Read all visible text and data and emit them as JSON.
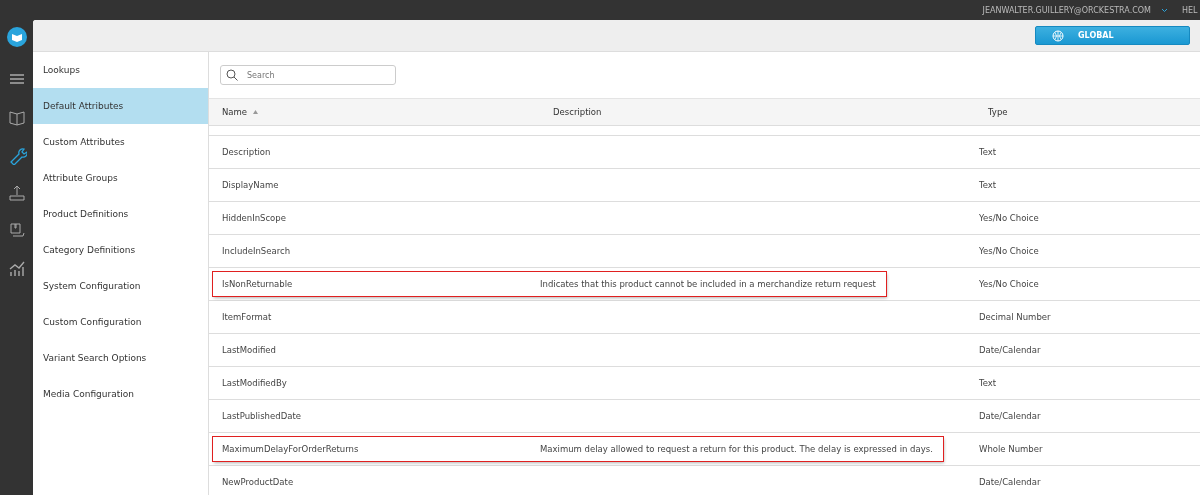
{
  "top_bar": {
    "user": "JEANWALTER.GUILLERY@ORCKESTRA.COM",
    "help": "HEL"
  },
  "rail": [
    {
      "kind": "menu",
      "selected": false
    },
    {
      "kind": "book",
      "selected": false
    },
    {
      "kind": "wrench",
      "selected": true
    },
    {
      "kind": "upload",
      "selected": false
    },
    {
      "kind": "box",
      "selected": false
    },
    {
      "kind": "chart",
      "selected": false
    }
  ],
  "scope_button": {
    "label": "GLOBAL"
  },
  "sidebar": {
    "items": [
      {
        "label": "Lookups",
        "selected": false
      },
      {
        "label": "Default Attributes",
        "selected": true
      },
      {
        "label": "Custom Attributes",
        "selected": false
      },
      {
        "label": "Attribute Groups",
        "selected": false
      },
      {
        "label": "Product Definitions",
        "selected": false
      },
      {
        "label": "Category Definitions",
        "selected": false
      },
      {
        "label": "System Configuration",
        "selected": false
      },
      {
        "label": "Custom Configuration",
        "selected": false
      },
      {
        "label": "Variant Search Options",
        "selected": false
      },
      {
        "label": "Media Configuration",
        "selected": false
      }
    ]
  },
  "search": {
    "placeholder": "Search"
  },
  "table": {
    "columns": [
      {
        "label": "Name",
        "sorted": true
      },
      {
        "label": "Description",
        "sorted": false
      },
      {
        "label": "Type",
        "sorted": false
      }
    ],
    "rows": [
      {
        "name": "Description",
        "type": "Text",
        "highlighted": false
      },
      {
        "name": "DisplayName",
        "type": "Text",
        "highlighted": false
      },
      {
        "name": "HiddenInScope",
        "type": "Yes/No Choice",
        "highlighted": false
      },
      {
        "name": "IncludeInSearch",
        "type": "Yes/No Choice",
        "highlighted": false
      },
      {
        "name": "IsNonReturnable",
        "description": "Indicates that this product cannot be included in a merchandize return request",
        "type": "Yes/No Choice",
        "highlighted": true
      },
      {
        "name": "ItemFormat",
        "type": "Decimal Number",
        "highlighted": false
      },
      {
        "name": "LastModified",
        "type": "Date/Calendar",
        "highlighted": false
      },
      {
        "name": "LastModifiedBy",
        "type": "Text",
        "highlighted": false
      },
      {
        "name": "LastPublishedDate",
        "type": "Date/Calendar",
        "highlighted": false
      },
      {
        "name": "MaximumDelayForOrderReturns",
        "description": "Maximum delay allowed to request a return for this product. The delay is expressed in days.",
        "type": "Whole Number",
        "highlighted": true
      },
      {
        "name": "NewProductDate",
        "type": "Date/Calendar",
        "highlighted": false
      }
    ]
  }
}
